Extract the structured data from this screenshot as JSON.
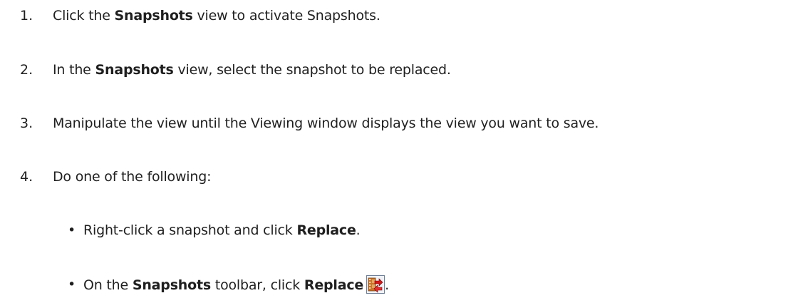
{
  "steps": [
    {
      "number": "1.",
      "pre": "Click the ",
      "bold": "Snapshots",
      "post": " view to activate Snapshots."
    },
    {
      "number": "2.",
      "pre": "In the ",
      "bold": "Snapshots",
      "post": " view, select the snapshot to be replaced."
    },
    {
      "number": "3.",
      "text": "Manipulate the view until the Viewing window displays the view you want to save."
    },
    {
      "number": "4.",
      "text": "Do one of the following:"
    }
  ],
  "bullets": [
    {
      "symbol": "•",
      "pre": "Right-click a snapshot and click ",
      "bold": "Replace",
      "post": "."
    },
    {
      "symbol": "•",
      "pre": "On the ",
      "bold1": "Snapshots",
      "mid": " toolbar, click ",
      "bold2": "Replace",
      "post": ".",
      "icon": "replace-snapshot-icon"
    }
  ]
}
